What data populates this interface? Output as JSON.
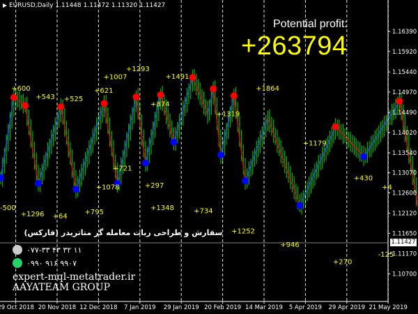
{
  "window": {
    "symbol": "EURUSD,Daily",
    "ohlc": [
      "1.11448",
      "1.11472",
      "1.11320",
      "1.11427"
    ]
  },
  "overlay": {
    "caption": "Potential profit:",
    "value": "+263794",
    "value_color": "#ffff00"
  },
  "brand": {
    "title": "سفارش و طراحی ربات معامله گر متاتریدر (فارکس)",
    "phone": "۰۷۷-۳۳ ۴۳ ۳۲ ۱۱",
    "whatsapp": "۰۹۹۰ ۹۱۶ ۹۹۰۷",
    "phone_icon": "phone-icon",
    "whatsapp_icon": "whatsapp-icon",
    "website": "expert-mql-metatrader.ir",
    "group": "AAYATEAM GROUP"
  },
  "colors": {
    "background": "#000000",
    "bar": "#00b400",
    "up_leg": "#1e50ff",
    "down_leg": "#e60000",
    "buy_dot": "#0000ff",
    "sell_dot": "#ff0000",
    "label": "#ffff00",
    "separator": "#ffffff",
    "current_price_bg": "#ffffff"
  },
  "chart_data": {
    "type": "line",
    "grid": false,
    "ylim": [
      1.1005,
      1.1713
    ],
    "x_tick_labels": [
      "29 Oct 2018",
      "20 Nov 2018",
      "12 Dec 2018",
      "7 Jan 2019",
      "29 Jan 2019",
      "20 Feb 2019",
      "14 Mar 2019",
      "5 Apr 2019",
      "29 Apr 2019",
      "21 May 2019"
    ],
    "y_tick_labels": [
      "1.16390",
      "1.15920",
      "1.15440",
      "1.14970",
      "1.14490",
      "1.14020",
      "1.13540",
      "1.13070",
      "1.12600",
      "1.12120",
      "1.11650",
      "1.11170",
      "1.10700"
    ],
    "current_price": "1.11427",
    "price_path": [
      [
        0,
        1.1295
      ],
      [
        7,
        1.1484
      ],
      [
        13,
        1.1465
      ],
      [
        20,
        1.1282
      ],
      [
        32,
        1.1462
      ],
      [
        40,
        1.1268
      ],
      [
        55,
        1.147
      ],
      [
        62,
        1.1282
      ],
      [
        72,
        1.1485
      ],
      [
        77,
        1.133
      ],
      [
        85,
        1.149
      ],
      [
        92,
        1.1379
      ],
      [
        102,
        1.1531
      ],
      [
        110,
        1.1444
      ],
      [
        113,
        1.1504
      ],
      [
        117,
        1.1349
      ],
      [
        124,
        1.1488
      ],
      [
        130,
        1.1288
      ],
      [
        142,
        1.1435
      ],
      [
        159,
        1.123
      ],
      [
        178,
        1.1415
      ],
      [
        193,
        1.1345
      ],
      [
        212,
        1.1475
      ],
      [
        225,
        1.115
      ],
      [
        243,
        1.1409
      ],
      [
        255,
        1.113
      ],
      [
        268,
        1.1273
      ],
      [
        285,
        1.11
      ],
      [
        302,
        1.1216
      ],
      [
        320,
        1.108
      ],
      [
        327,
        1.1148
      ]
    ],
    "series": [
      {
        "name": "Sell signals",
        "points": [
          [
            7,
            1.1484
          ],
          [
            13,
            1.1465
          ],
          [
            32,
            1.1462
          ],
          [
            55,
            1.147
          ],
          [
            72,
            1.1485
          ],
          [
            85,
            1.149
          ],
          [
            102,
            1.1531
          ],
          [
            113,
            1.1504
          ],
          [
            124,
            1.1488
          ],
          [
            178,
            1.1415
          ],
          [
            212,
            1.1475
          ],
          [
            255,
            1.113
          ],
          [
            302,
            1.1216
          ]
        ]
      },
      {
        "name": "Buy signals",
        "points": [
          [
            0,
            1.1295
          ],
          [
            20,
            1.1282
          ],
          [
            40,
            1.1268
          ],
          [
            62,
            1.1282
          ],
          [
            77,
            1.133
          ],
          [
            92,
            1.1379
          ],
          [
            117,
            1.1349
          ],
          [
            130,
            1.1288
          ],
          [
            159,
            1.123
          ],
          [
            193,
            1.1345
          ],
          [
            225,
            1.115
          ],
          [
            285,
            1.11
          ],
          [
            320,
            1.108
          ]
        ]
      }
    ],
    "annotations": [
      {
        "text": "+600",
        "x": 6,
        "y": 1.15
      },
      {
        "text": "+543",
        "x": 19,
        "y": 1.148
      },
      {
        "text": "+525",
        "x": 34,
        "y": 1.1475
      },
      {
        "text": "+621",
        "x": 50,
        "y": 1.1495
      },
      {
        "text": "+1007",
        "x": 55,
        "y": 1.1527
      },
      {
        "text": "+1293",
        "x": 67,
        "y": 1.1546
      },
      {
        "text": "+1491",
        "x": 88,
        "y": 1.1528
      },
      {
        "text": "+874",
        "x": 80,
        "y": 1.1463
      },
      {
        "text": "+1319",
        "x": 115,
        "y": 1.144
      },
      {
        "text": "+1864",
        "x": 136,
        "y": 1.15
      },
      {
        "text": "+1179",
        "x": 161,
        "y": 1.1371
      },
      {
        "text": "+430",
        "x": 188,
        "y": 1.1289
      },
      {
        "text": "+4",
        "x": 203,
        "y": 1.1268
      },
      {
        "text": "-500",
        "x": 0,
        "y": 1.122
      },
      {
        "text": "+1296",
        "x": 11,
        "y": 1.1205
      },
      {
        "text": "+64",
        "x": 28,
        "y": 1.12
      },
      {
        "text": "+795",
        "x": 45,
        "y": 1.121
      },
      {
        "text": "+1078",
        "x": 51,
        "y": 1.1268
      },
      {
        "text": "+721",
        "x": 60,
        "y": 1.1312
      },
      {
        "text": "+297",
        "x": 77,
        "y": 1.1272
      },
      {
        "text": "+1348",
        "x": 80,
        "y": 1.122
      },
      {
        "text": "+734",
        "x": 103,
        "y": 1.1212
      },
      {
        "text": "+1252",
        "x": 123,
        "y": 1.1165
      },
      {
        "text": "+946",
        "x": 149,
        "y": 1.1133
      },
      {
        "text": "+270",
        "x": 177,
        "y": 1.1093
      },
      {
        "text": "-125",
        "x": 201,
        "y": 1.111
      }
    ]
  }
}
